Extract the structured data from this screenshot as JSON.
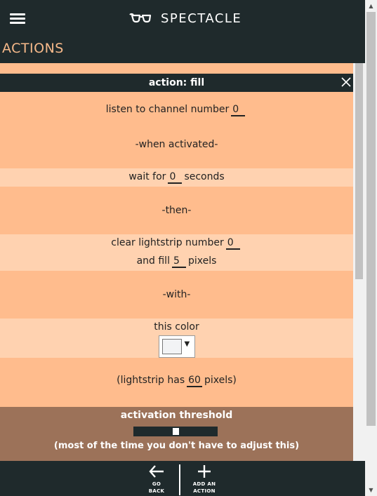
{
  "header": {
    "brand": "SPECTACLE",
    "logo_icon": "spectacles-icon",
    "menu_icon": "hamburger-menu-icon"
  },
  "section": {
    "title": "ACTIONS"
  },
  "action": {
    "title": "action: fill",
    "close_icon": "close-icon",
    "channel_label": "listen to channel number",
    "channel_value": "0",
    "when_activated": "-when activated-",
    "wait_label": "wait for",
    "wait_value": "0",
    "wait_unit": "seconds",
    "then": "-then-",
    "clear_label": "clear lightstrip number",
    "clear_value": "0",
    "fill_label": "and fill",
    "fill_value": "5",
    "fill_unit": "pixels",
    "with": "-with-",
    "color_label": "this color",
    "color_value": "#f2f3f5",
    "lightstrip_prefix": "(lightstrip has",
    "lightstrip_value": "60",
    "lightstrip_suffix": "pixels)"
  },
  "threshold": {
    "title": "activation threshold",
    "slider_level": 0.5,
    "note": "(most of the time you don't have to adjust this)"
  },
  "bottom_nav": {
    "back_line1": "GO",
    "back_line2": "BACK",
    "add_line1": "ADD AN",
    "add_line2": "ACTION"
  },
  "colors": {
    "dark": "#1f2a2c",
    "accent": "#f6b98a",
    "panel": "#ffbc8d",
    "panel_light": "#ffd2b0",
    "threshold_bg": "#9c7259"
  }
}
